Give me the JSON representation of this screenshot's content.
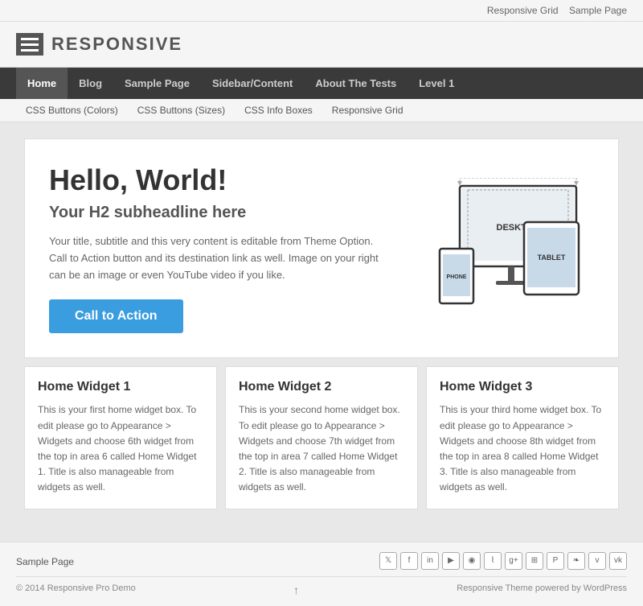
{
  "topbar": {
    "links": [
      "Responsive Grid",
      "Sample Page"
    ]
  },
  "header": {
    "logo_text": "RESPONSIVE"
  },
  "main_nav": {
    "items": [
      {
        "label": "Home",
        "active": true
      },
      {
        "label": "Blog"
      },
      {
        "label": "Sample Page"
      },
      {
        "label": "Sidebar/Content"
      },
      {
        "label": "About The Tests"
      },
      {
        "label": "Level 1"
      }
    ]
  },
  "sub_nav": {
    "items": [
      {
        "label": "CSS Buttons (Colors)"
      },
      {
        "label": "CSS Buttons (Sizes)"
      },
      {
        "label": "CSS Info Boxes"
      },
      {
        "label": "Responsive Grid"
      }
    ]
  },
  "hero": {
    "h1": "Hello, World!",
    "h2": "Your H2 subheadline here",
    "body": "Your title, subtitle and this very content is editable from Theme Option. Call to Action button and its destination link as well. Image on your right can be an image or even YouTube video if you like.",
    "cta_label": "Call to Action",
    "device_desktop_label": "DESKTOP",
    "device_tablet_label": "TABLET",
    "device_phone_label": "PHONE"
  },
  "widgets": [
    {
      "title": "Home Widget 1",
      "body": "This is your first home widget box. To edit please go to Appearance > Widgets and choose 6th widget from the top in area 6 called Home Widget 1. Title is also manageable from widgets as well."
    },
    {
      "title": "Home Widget 2",
      "body": "This is your second home widget box. To edit please go to Appearance > Widgets and choose 7th widget from the top in area 7 called Home Widget 2. Title is also manageable from widgets as well."
    },
    {
      "title": "Home Widget 3",
      "body": "This is your third home widget box. To edit please go to Appearance > Widgets and choose 8th widget from the top in area 8 called Home Widget 3. Title is also manageable from widgets as well."
    }
  ],
  "footer": {
    "left_link": "Sample Page",
    "copyright": "© 2014 Responsive Pro Demo",
    "powered_by": "Responsive Theme powered by WordPress",
    "icons": [
      "t",
      "f",
      "in",
      "y",
      "o",
      "rss",
      "g+",
      "p",
      "pin",
      "❧",
      "v",
      "vk"
    ]
  }
}
